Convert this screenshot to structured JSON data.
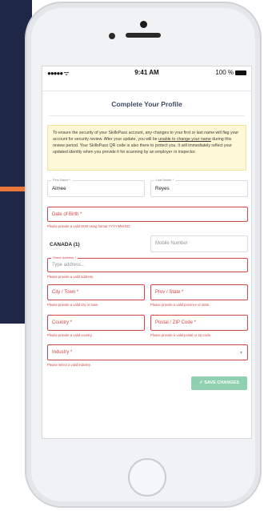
{
  "status_bar": {
    "signal": "●●●●● ᯤ",
    "time": "9:41 AM",
    "battery": "100 %"
  },
  "page": {
    "title": "Complete Your Profile"
  },
  "notice": {
    "text_before": "To ensure the security of your SkillsPass account, any changes to your first or last name will flag your account for security review. After your update, you will be ",
    "link1": "unable to change your name",
    "text_middle": " during this review period. Your SkillsPass QR code is also there to protect you. It will immediately reflect your updated identity when you provide it for scanning by an employer or inspector."
  },
  "form": {
    "first_name": {
      "label": "First Name *",
      "value": "Aimee"
    },
    "last_name": {
      "label": "Last Name *",
      "value": "Reyes"
    },
    "dob": {
      "placeholder": "Date of Birth *",
      "error": "Please provide a valid DOB using format YYYY-MM-DD."
    },
    "country_code": "CANADA (1)",
    "mobile": {
      "placeholder": "Mobile Number"
    },
    "street": {
      "label": "Street Address *",
      "placeholder": "Type address...",
      "error": "Please provide a valid address."
    },
    "city": {
      "placeholder": "City / Town *",
      "error": "Please provide a valid city or town."
    },
    "prov": {
      "placeholder": "Prov / State *",
      "error": "Please provide a valid province or state."
    },
    "country": {
      "placeholder": "Country *",
      "error": "Please provide a valid country."
    },
    "postal": {
      "placeholder": "Postal / ZIP Code *",
      "error": "Please provide a valid postal or zip code."
    },
    "industry": {
      "placeholder": "Industry *",
      "error": "Please select a valid industry."
    },
    "save_label": "✓ SAVE CHANGES"
  },
  "colors": {
    "accent": "#8fd0b0",
    "error": "#d94545",
    "navy": "#1e2745",
    "orange": "#e9773a"
  }
}
